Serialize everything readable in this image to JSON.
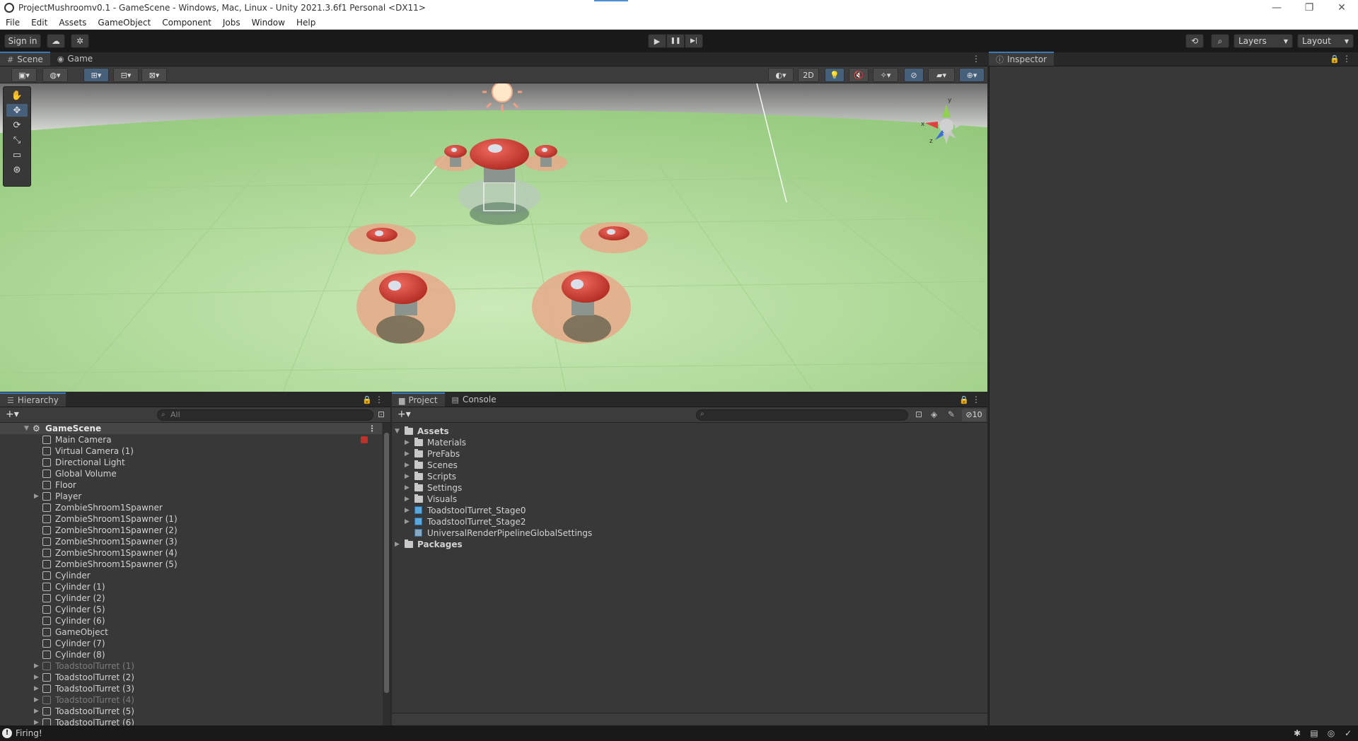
{
  "window": {
    "title": "ProjectMushroomv0.1 - GameScene - Windows, Mac, Linux - Unity 2021.3.6f1 Personal <DX11>",
    "controls": [
      "—",
      "❐",
      "✕"
    ]
  },
  "menu": [
    "File",
    "Edit",
    "Assets",
    "GameObject",
    "Component",
    "Jobs",
    "Window",
    "Help"
  ],
  "toolbar": {
    "sign_in": "Sign in",
    "play": "▶",
    "pause": "❚❚",
    "step": "▶|",
    "layers": "Layers",
    "layout": "Layout"
  },
  "scene_tabs": [
    {
      "label": "Scene",
      "icon": "grid-icon",
      "active": true
    },
    {
      "label": "Game",
      "icon": "gamepad-icon",
      "active": false
    }
  ],
  "scene_toolbar": {
    "mode_2d": "2D"
  },
  "inspector": {
    "title": "Inspector"
  },
  "hierarchy": {
    "title": "Hierarchy",
    "search_placeholder": "All",
    "items": [
      {
        "label": "GameScene",
        "depth": 0,
        "type": "scene",
        "expanded": true
      },
      {
        "label": "Main Camera",
        "depth": 1
      },
      {
        "label": "Virtual Camera (1)",
        "depth": 1
      },
      {
        "label": "Directional Light",
        "depth": 1
      },
      {
        "label": "Global Volume",
        "depth": 1
      },
      {
        "label": "Floor",
        "depth": 1
      },
      {
        "label": "Player",
        "depth": 1,
        "collapsed": true
      },
      {
        "label": "ZombieShroom1Spawner",
        "depth": 1
      },
      {
        "label": "ZombieShroom1Spawner (1)",
        "depth": 1
      },
      {
        "label": "ZombieShroom1Spawner (2)",
        "depth": 1
      },
      {
        "label": "ZombieShroom1Spawner (3)",
        "depth": 1
      },
      {
        "label": "ZombieShroom1Spawner (4)",
        "depth": 1
      },
      {
        "label": "ZombieShroom1Spawner (5)",
        "depth": 1
      },
      {
        "label": "Cylinder",
        "depth": 1
      },
      {
        "label": "Cylinder (1)",
        "depth": 1
      },
      {
        "label": "Cylinder (2)",
        "depth": 1
      },
      {
        "label": "Cylinder (5)",
        "depth": 1
      },
      {
        "label": "Cylinder (6)",
        "depth": 1
      },
      {
        "label": "GameObject",
        "depth": 1
      },
      {
        "label": "Cylinder (7)",
        "depth": 1
      },
      {
        "label": "Cylinder (8)",
        "depth": 1
      },
      {
        "label": "ToadstoolTurret (1)",
        "depth": 1,
        "collapsed": true,
        "inactive": true
      },
      {
        "label": "ToadstoolTurret (2)",
        "depth": 1,
        "collapsed": true
      },
      {
        "label": "ToadstoolTurret (3)",
        "depth": 1,
        "collapsed": true
      },
      {
        "label": "ToadstoolTurret (4)",
        "depth": 1,
        "collapsed": true,
        "inactive": true
      },
      {
        "label": "ToadstoolTurret (5)",
        "depth": 1,
        "collapsed": true
      },
      {
        "label": "ToadstoolTurret (6)",
        "depth": 1,
        "collapsed": true
      }
    ]
  },
  "project": {
    "tabs": [
      {
        "label": "Project",
        "icon": "folder-icon",
        "active": true
      },
      {
        "label": "Console",
        "icon": "console-icon",
        "active": false
      }
    ],
    "hidden_count": "10",
    "items": [
      {
        "label": "Assets",
        "depth": 0,
        "kind": "folder",
        "expanded": true,
        "bold": true
      },
      {
        "label": "Materials",
        "depth": 1,
        "kind": "folder"
      },
      {
        "label": "PreFabs",
        "depth": 1,
        "kind": "folder"
      },
      {
        "label": "Scenes",
        "depth": 1,
        "kind": "folder"
      },
      {
        "label": "Scripts",
        "depth": 1,
        "kind": "folder"
      },
      {
        "label": "Settings",
        "depth": 1,
        "kind": "folder"
      },
      {
        "label": "Visuals",
        "depth": 1,
        "kind": "folder"
      },
      {
        "label": "ToadstoolTurret_Stage0",
        "depth": 1,
        "kind": "prefab"
      },
      {
        "label": "ToadstoolTurret_Stage2",
        "depth": 1,
        "kind": "prefab"
      },
      {
        "label": "UniversalRenderPipelineGlobalSettings",
        "depth": 1,
        "kind": "asset",
        "no_arrow": true
      },
      {
        "label": "Packages",
        "depth": 0,
        "kind": "folder",
        "bold": true
      }
    ]
  },
  "status": {
    "message": "Firing!"
  },
  "colors": {
    "accent": "#3a79bb",
    "ground": "#a8d690",
    "mushroom_cap": "#d9413a",
    "plate": "#e8a98a"
  }
}
